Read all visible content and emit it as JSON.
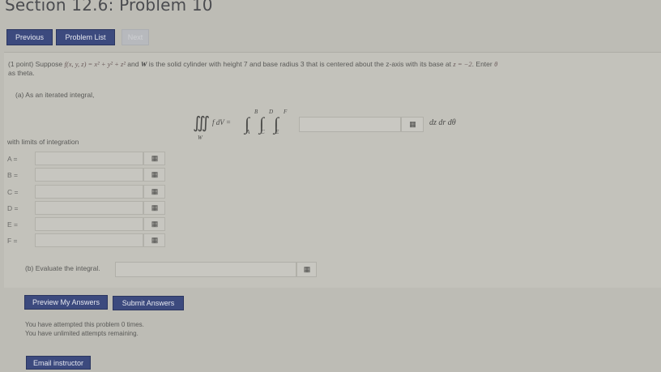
{
  "page": {
    "title": "Section 12.6: Problem 10"
  },
  "nav": {
    "previous": "Previous",
    "problem_list": "Problem List",
    "next": "Next"
  },
  "problem": {
    "points": "(1 point)",
    "text_suppose": "Suppose",
    "f_expr": "f(x, y, z) = x² + y² + z²",
    "text_and": "and",
    "W": "W",
    "text_rest": "is the solid cylinder with height 7 and base radius 3 that is centered about the z-axis with its base at",
    "base_expr": "z = −2",
    "text_enter": ". Enter",
    "theta": "θ",
    "text_as_theta": "as theta."
  },
  "part_a": {
    "label": "(a) As an iterated integral,",
    "integrand_left": "∭",
    "f_dV": "f dV =",
    "W_sub": "W",
    "limits_upper": [
      "B",
      "D",
      "F"
    ],
    "limits_lower": [
      "A",
      "C",
      "E"
    ],
    "differentials": "dz dr dθ",
    "answer_value": "",
    "icon": "grid-icon"
  },
  "limits": {
    "label": "with limits of integration",
    "rows": [
      {
        "label": "A =",
        "value": ""
      },
      {
        "label": "B =",
        "value": ""
      },
      {
        "label": "C =",
        "value": ""
      },
      {
        "label": "D =",
        "value": ""
      },
      {
        "label": "E =",
        "value": ""
      },
      {
        "label": "F =",
        "value": ""
      }
    ]
  },
  "part_b": {
    "label": "(b) Evaluate the integral.",
    "value": ""
  },
  "buttons": {
    "preview": "Preview My Answers",
    "submit": "Submit Answers",
    "email": "Email instructor"
  },
  "attempts": {
    "line1": "You have attempted this problem 0 times.",
    "line2": "You have unlimited attempts remaining."
  },
  "colors": {
    "button": "#3c4a7e",
    "background": "#bdbcb5"
  }
}
